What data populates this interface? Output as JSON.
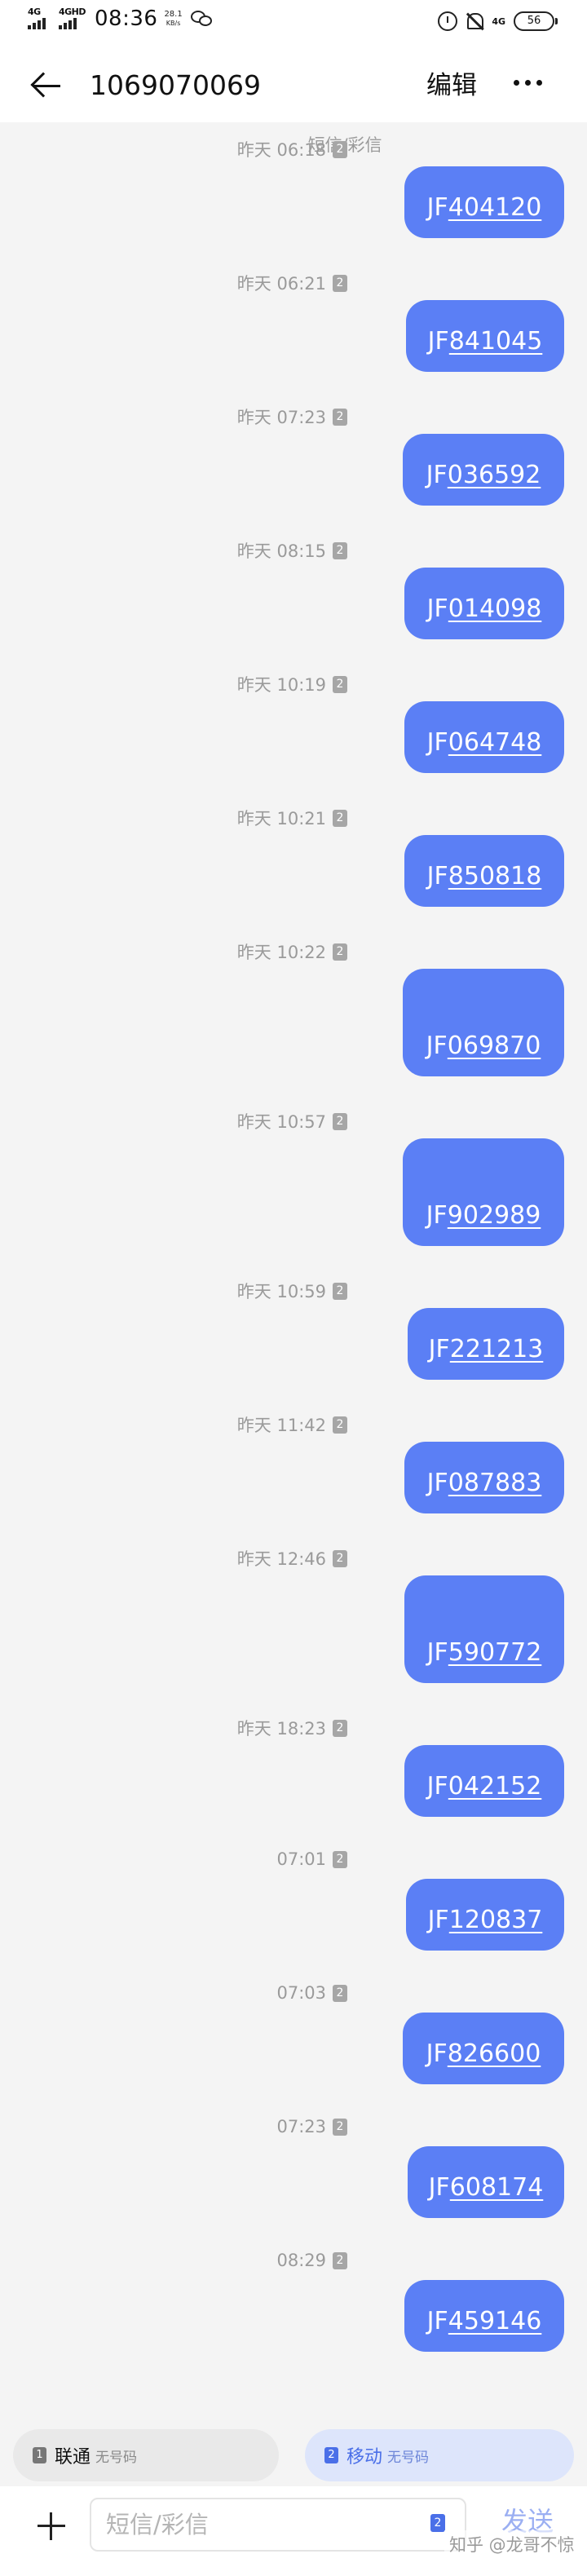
{
  "status_bar": {
    "network_1": "4G",
    "network_2": "4GHD",
    "time": "08:36",
    "speed_value": "28.1",
    "speed_unit": "KB/s",
    "network_small": "4G",
    "battery": "56"
  },
  "header": {
    "contact": "1069070069",
    "edit_label": "编辑"
  },
  "thread": {
    "channel_label": "短信/彩信",
    "messages": [
      {
        "time": "昨天 06:18",
        "sim": "2",
        "prefix": "JF",
        "code": "404120"
      },
      {
        "time": "昨天 06:21",
        "sim": "2",
        "prefix": "JF",
        "code": "841045"
      },
      {
        "time": "昨天 07:23",
        "sim": "2",
        "prefix": "JF",
        "code": "036592"
      },
      {
        "time": "昨天 08:15",
        "sim": "2",
        "prefix": "JF",
        "code": "014098"
      },
      {
        "time": "昨天 10:19",
        "sim": "2",
        "prefix": "JF",
        "code": "064748"
      },
      {
        "time": "昨天 10:21",
        "sim": "2",
        "prefix": "JF",
        "code": "850818"
      },
      {
        "time": "昨天 10:22",
        "sim": "2",
        "prefix": "JF",
        "code": "069870"
      },
      {
        "time": "昨天 10:57",
        "sim": "2",
        "prefix": "JF",
        "code": "902989"
      },
      {
        "time": "昨天 10:59",
        "sim": "2",
        "prefix": "JF",
        "code": "221213"
      },
      {
        "time": "昨天 11:42",
        "sim": "2",
        "prefix": "JF",
        "code": "087883"
      },
      {
        "time": "昨天 12:46",
        "sim": "2",
        "prefix": "JF",
        "code": "590772"
      },
      {
        "time": "昨天 18:23",
        "sim": "2",
        "prefix": "JF",
        "code": "042152"
      },
      {
        "time": "07:01",
        "sim": "2",
        "prefix": "JF",
        "code": "120837"
      },
      {
        "time": "07:03",
        "sim": "2",
        "prefix": "JF",
        "code": "826600"
      },
      {
        "time": "07:23",
        "sim": "2",
        "prefix": "JF",
        "code": "608174"
      },
      {
        "time": "08:29",
        "sim": "2",
        "prefix": "JF",
        "code": "459146"
      }
    ]
  },
  "sim_selector": {
    "unicom": {
      "num": "1",
      "name": "联通",
      "sub": "无号码"
    },
    "mobile": {
      "num": "2",
      "name": "移动",
      "sub": "无号码"
    }
  },
  "compose": {
    "placeholder": "短信/彩信",
    "sim": "2",
    "send_label": "发送",
    "watermark": "知乎 @龙哥不惊"
  },
  "colors": {
    "bubble": "#5b7ff5",
    "accent": "#4a6fe8",
    "background": "#f4f4f4"
  },
  "icons": {
    "back": "back-arrow-icon",
    "more": "more-dots-icon",
    "add": "plus-icon",
    "alarm": "alarm-icon",
    "mute": "bell-off-icon",
    "wechat": "wechat-icon"
  }
}
